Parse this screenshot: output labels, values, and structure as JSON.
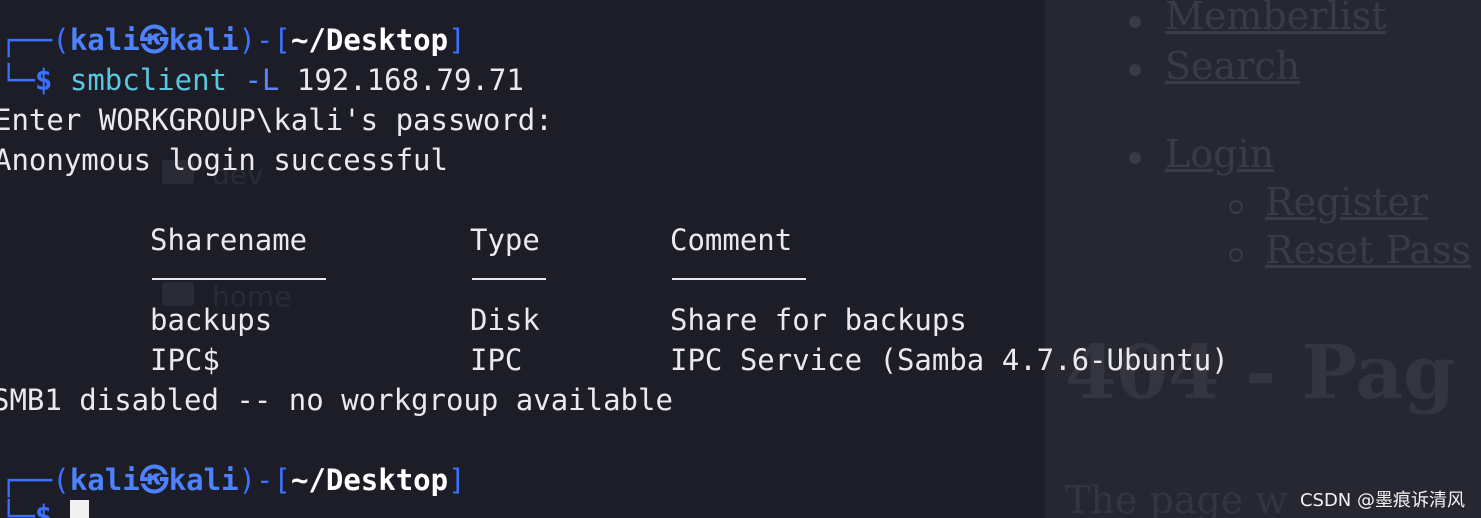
{
  "terminal": {
    "prompt1": {
      "frame_top": "┌──(",
      "user": "kali",
      "skull": "㉿",
      "host": "kali",
      "mid": ")-[",
      "path": "~/Desktop",
      "end": "]"
    },
    "command": {
      "frame_bottom": "└─",
      "dollar": "$",
      "cmd": "smbclient",
      "flag": "-L",
      "arg": "192.168.79.71"
    },
    "output_password": "Enter WORKGROUP\\kali's password:",
    "output_login": "Anonymous login successful",
    "table_headers": {
      "sharename": "Sharename",
      "type": "Type",
      "comment": "Comment"
    },
    "rows": [
      {
        "sharename": "backups",
        "type": "Disk",
        "comment": "Share for backups"
      },
      {
        "sharename": "IPC$",
        "type": "IPC",
        "comment": "IPC Service (Samba 4.7.6-Ubuntu)"
      }
    ],
    "output_smb1": "SMB1 disabled -- no workgroup available",
    "prompt2": {
      "frame_top": "┌──(",
      "user": "kali",
      "skull": "㉿",
      "host": "kali",
      "mid": ")-[",
      "path": "~/Desktop",
      "end": "]"
    },
    "prompt2_bottom": {
      "frame_bottom": "└─",
      "dollar": "$"
    }
  },
  "background_page": {
    "items": [
      "Memberlist",
      "Search",
      "Login"
    ],
    "subitems": [
      "Register",
      "Reset Pass"
    ],
    "heading": "404 - Pag",
    "text": "The page w"
  },
  "background_tree": {
    "items": [
      "dev",
      "home"
    ]
  },
  "watermark": "CSDN @墨痕诉清风"
}
